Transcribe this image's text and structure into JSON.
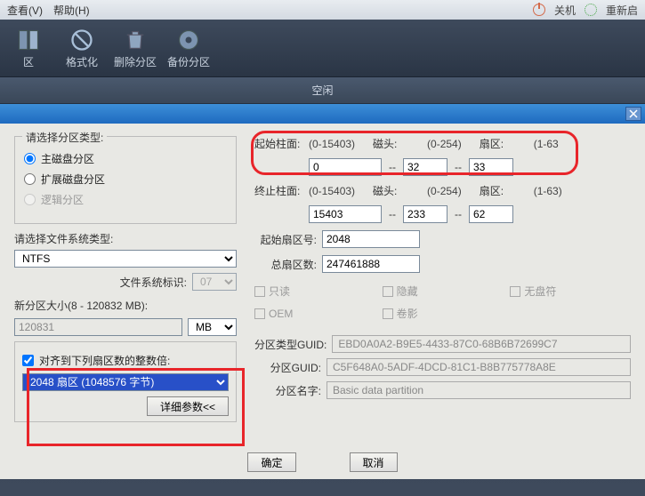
{
  "menu": {
    "view": "查看(V)",
    "help": "帮助(H)"
  },
  "status": {
    "shutdown": "关机",
    "restart": "重新启"
  },
  "toolbar": {
    "item1": "区",
    "item2": "格式化",
    "item3": "删除分区",
    "item4": "备份分区"
  },
  "divider_label": "空闲",
  "left": {
    "type_label": "请选择分区类型:",
    "radio1": "主磁盘分区",
    "radio2": "扩展磁盘分区",
    "radio3": "逻辑分区",
    "fs_label": "请选择文件系统类型:",
    "fs_value": "NTFS",
    "fsid_label": "文件系统标识:",
    "fsid_value": "07",
    "size_label": "新分区大小(8 - 120832 MB):",
    "size_value": "120831",
    "size_unit": "MB",
    "align_chk": "对齐到下列扇区数的整数倍:",
    "align_value": "2048 扇区 (1048576 字节)",
    "detail_btn": "详细参数<<"
  },
  "right": {
    "start_cyl": "起始柱面:",
    "start_cyl_range": "(0-15403)",
    "start_cyl_val": "0",
    "head": "磁头:",
    "head_range": "(0-254)",
    "start_head_val": "32",
    "sector": "扇区:",
    "sector_range": "(1-63",
    "start_sec_val": "33",
    "end_cyl": "终止柱面:",
    "end_cyl_range": "(0-15403)",
    "end_cyl_val": "15403",
    "end_head_val": "233",
    "end_sec_val": "62",
    "start_sector_no": "起始扇区号:",
    "start_sector_no_val": "2048",
    "total_sectors": "总扇区数:",
    "total_sectors_val": "247461888",
    "chk_readonly": "只读",
    "chk_hidden": "隐藏",
    "chk_noletter": "无盘符",
    "chk_oem": "OEM",
    "chk_shadow": "卷影",
    "type_guid_lbl": "分区类型GUID:",
    "type_guid_val": "EBD0A0A2-B9E5-4433-87C0-68B6B72699C7",
    "part_guid_lbl": "分区GUID:",
    "part_guid_val": "C5F648A0-5ADF-4DCD-81C1-B8B775778A8E",
    "part_name_lbl": "分区名字:",
    "part_name_val": "Basic data partition"
  },
  "footer": {
    "ok": "确定",
    "cancel": "取消"
  }
}
